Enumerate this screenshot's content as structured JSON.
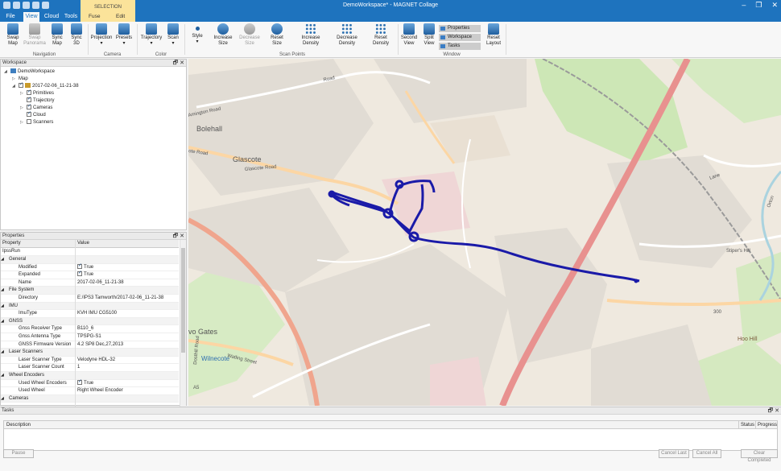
{
  "window": {
    "title": "DemoWorkspace* - MAGNET Collage",
    "minimize": "–",
    "maximize": "❐",
    "close": "✕"
  },
  "tabs": [
    "File",
    "View",
    "Cloud",
    "Tools"
  ],
  "selection": {
    "header": "SELECTION",
    "tabs": [
      "Fuse",
      "Edit"
    ]
  },
  "ribbon": {
    "swap_map": "Swap\nMap",
    "swap_panorama": "Swap\nPanorama",
    "sync_map": "Sync\nMap",
    "sync_3d": "Sync\n3D",
    "projection": "Projection",
    "presets": "Presets",
    "trajectory": "Trajectory",
    "scan": "Scan",
    "style": "Style",
    "increase_size": "Increase\nSize",
    "decrease_size": "Decrease\nSize",
    "reset_size": "Reset\nSize",
    "increase_density": "Increase\nDensity",
    "decrease_density": "Decrease\nDensity",
    "reset_density": "Reset\nDensity",
    "second_view": "Second\nView",
    "split_view": "Split\nView",
    "reset_layout": "Reset\nLayout",
    "window_items": [
      "Properties",
      "Workspace",
      "Tasks"
    ],
    "groups": {
      "navigation": "Navigation",
      "camera": "Camera",
      "color": "Color",
      "scan_points": "Scan Points",
      "window": "Window"
    }
  },
  "workspace": {
    "title": "Workspace",
    "root": "DemoWorkspace",
    "map": "Map",
    "run": "2017-02-06_11-21-38",
    "items": [
      {
        "label": "Primitives",
        "checked": true
      },
      {
        "label": "Trajectory",
        "checked": true
      },
      {
        "label": "Cameras",
        "checked": true
      },
      {
        "label": "Cloud",
        "checked": true
      },
      {
        "label": "Scanners",
        "checked": false
      }
    ]
  },
  "properties": {
    "title": "Properties",
    "col_property": "Property",
    "col_value": "Value",
    "root": "IpssRun",
    "rows": [
      {
        "type": "cat",
        "key": "General"
      },
      {
        "type": "prop",
        "key": "Modified",
        "value": "True",
        "check": true
      },
      {
        "type": "prop",
        "key": "Expanded",
        "value": "True",
        "check": true
      },
      {
        "type": "prop",
        "key": "Name",
        "value": "2017-02-06_11-21-38"
      },
      {
        "type": "cat",
        "key": "File System"
      },
      {
        "type": "prop",
        "key": "Directory",
        "value": "E:/IPS3 Tamworth/2017-02-06_11-21-38"
      },
      {
        "type": "cat",
        "key": "IMU"
      },
      {
        "type": "prop",
        "key": "ImuType",
        "value": "KVH IMU CG5100"
      },
      {
        "type": "cat",
        "key": "GNSS"
      },
      {
        "type": "prop",
        "key": "Gnss Receiver Type",
        "value": "B110_6"
      },
      {
        "type": "prop",
        "key": "Gnss Antenna Type",
        "value": "TPSPG-S1"
      },
      {
        "type": "prop",
        "key": "GNSS Firmware Version",
        "value": "4.2 SP8 Dec,27,2013"
      },
      {
        "type": "cat",
        "key": "Laser Scanners"
      },
      {
        "type": "prop",
        "key": "Laser Scanner Type",
        "value": "Velodyne HDL-32"
      },
      {
        "type": "prop",
        "key": "Laser Scanner Count",
        "value": "1"
      },
      {
        "type": "cat",
        "key": "Wheel Encoders"
      },
      {
        "type": "prop",
        "key": "Used Wheel Encoders",
        "value": "True",
        "check": true
      },
      {
        "type": "prop",
        "key": "Used Wheel",
        "value": "Right Wheel Encoder"
      },
      {
        "type": "cat",
        "key": "Cameras"
      }
    ]
  },
  "map_labels": {
    "bolehall": "Bolehall",
    "glascote": "Glascote",
    "glascote_road": "Glascote Road",
    "glascote_road2": "ote Road",
    "amington": "Amington Road",
    "road": "Road",
    "gates": "vo Gates",
    "wilnecote": "Wilnecote",
    "watling": "Watling Street",
    "dosthill": "Dosthill Road",
    "stipers": "Stiper's Hill",
    "hoo": "Hoo Hill",
    "r300": "300",
    "a5": "A5",
    "lane": "Lane",
    "orton": "Orton"
  },
  "tasks": {
    "title": "Tasks",
    "col_description": "Description",
    "col_status": "Status",
    "col_progress": "Progress",
    "pause": "Pause",
    "cancel_last": "Cancel Last",
    "cancel_all": "Cancel All",
    "clear_completed": "Clear Completed"
  },
  "colors": {
    "accent": "#1e73be",
    "selection": "#fbe39a",
    "trajectory": "#1a1aa8"
  }
}
